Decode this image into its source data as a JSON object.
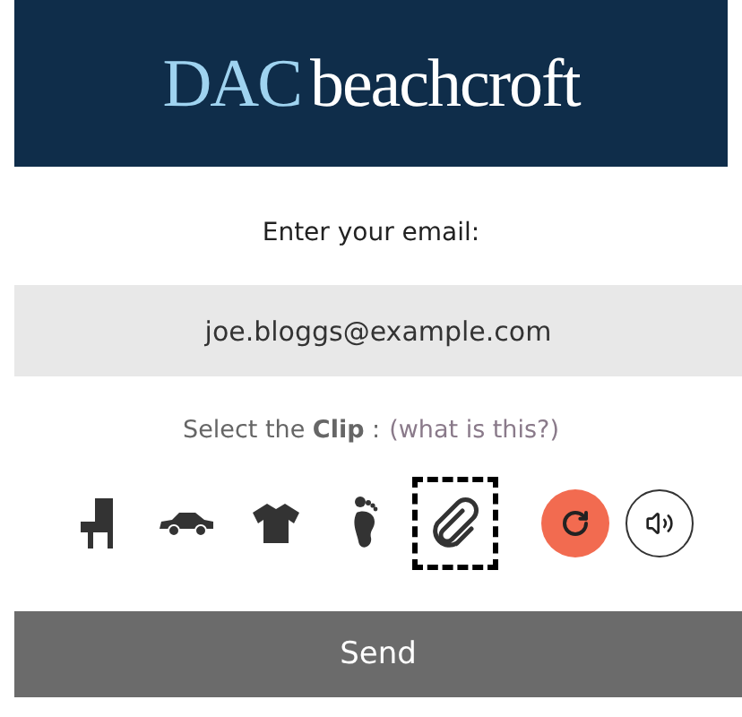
{
  "logo": {
    "part_1": "DAC",
    "part_2": "beachcroft"
  },
  "email": {
    "label": "Enter your email:",
    "value": "joe.bloggs@example.com"
  },
  "captcha": {
    "prompt": "Select the **Clip** :",
    "help_link": "(what is this?)",
    "options": [
      {
        "kind": "chair",
        "selected": false
      },
      {
        "kind": "car",
        "selected": false
      },
      {
        "kind": "shirt",
        "selected": false
      },
      {
        "kind": "foot",
        "selected": false
      },
      {
        "kind": "clip",
        "selected": true
      }
    ]
  },
  "send_button": "Send"
}
